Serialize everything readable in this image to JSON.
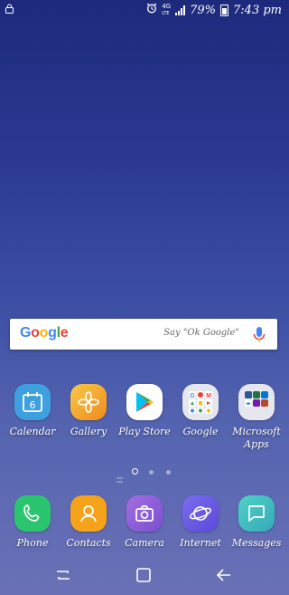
{
  "status_bar": {
    "network_label": "4G",
    "network_sub": "LTE",
    "battery": "79%",
    "time": "7:43 pm"
  },
  "search": {
    "logo_letters": [
      {
        "ch": "G",
        "color": "#4285F4"
      },
      {
        "ch": "o",
        "color": "#EA4335"
      },
      {
        "ch": "o",
        "color": "#FBBC05"
      },
      {
        "ch": "g",
        "color": "#4285F4"
      },
      {
        "ch": "l",
        "color": "#34A853"
      },
      {
        "ch": "e",
        "color": "#EA4335"
      }
    ],
    "hint": "Say \"Ok Google\""
  },
  "apps": [
    {
      "label": "Calendar",
      "icon": "calendar-icon",
      "color": "#3fa0e0",
      "detail": "6"
    },
    {
      "label": "Gallery",
      "icon": "gallery-icon",
      "color": "#f5a623"
    },
    {
      "label": "Play Store",
      "icon": "play-store-icon",
      "color": "#ffffff"
    },
    {
      "label": "Google",
      "icon": "google-folder-icon",
      "color": "#e8e8ec"
    },
    {
      "label": "Microsoft Apps",
      "icon": "microsoft-folder-icon",
      "color": "#e8e8ec"
    }
  ],
  "dock": [
    {
      "label": "Phone",
      "icon": "phone-icon",
      "color": "#2ecc71"
    },
    {
      "label": "Contacts",
      "icon": "contacts-icon",
      "color": "#f39c12"
    },
    {
      "label": "Camera",
      "icon": "camera-icon",
      "color": "#9b59b6"
    },
    {
      "label": "Internet",
      "icon": "internet-icon",
      "color": "#6c5ce7"
    },
    {
      "label": "Messages",
      "icon": "messages-icon",
      "color": "#3ec7c0"
    }
  ]
}
